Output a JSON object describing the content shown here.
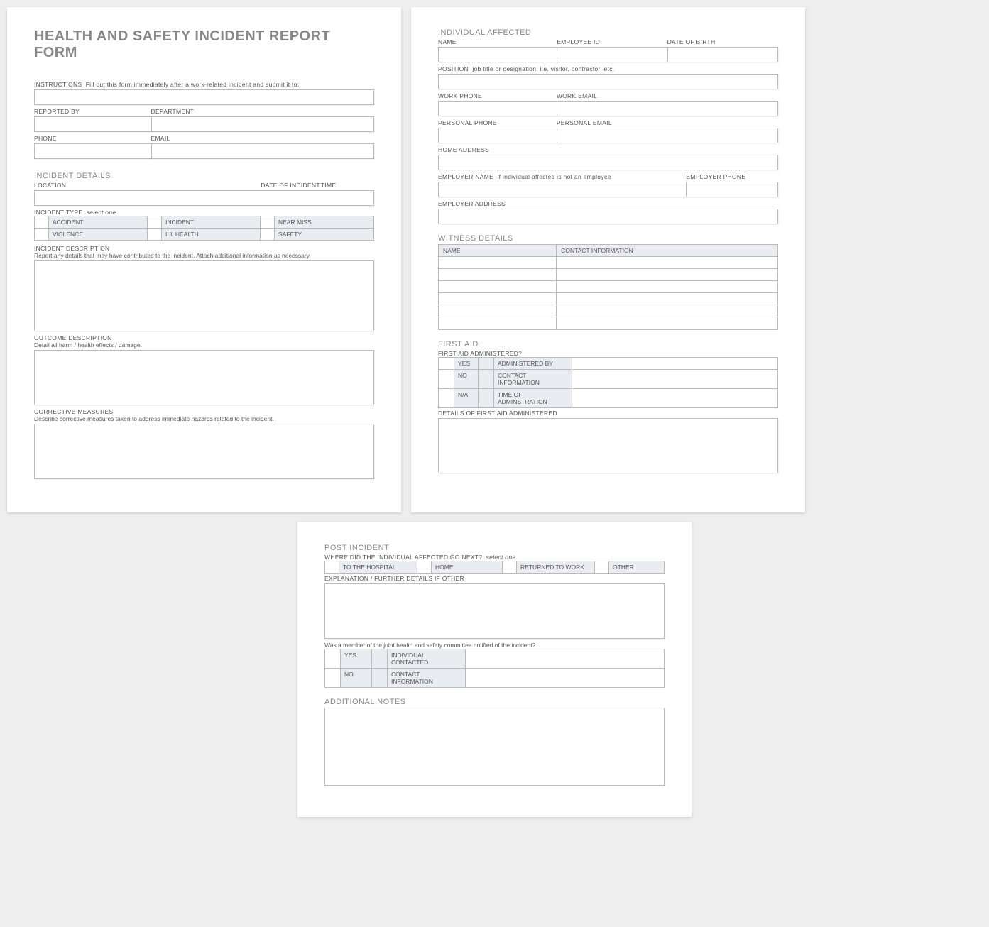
{
  "title": "HEALTH AND SAFETY INCIDENT REPORT FORM",
  "instructions": {
    "label": "INSTRUCTIONS",
    "text": "Fill out this form immediately after a work-related incident and submit it to:"
  },
  "reporter": {
    "reported_by_label": "REPORTED BY",
    "department_label": "DEPARTMENT",
    "phone_label": "PHONE",
    "email_label": "EMAIL"
  },
  "incident_details": {
    "heading": "INCIDENT DETAILS",
    "location_label": "LOCATION",
    "date_label": "DATE OF INCIDENT",
    "time_label": "TIME",
    "type_label": "INCIDENT TYPE",
    "select_one": "select one",
    "types": [
      "ACCIDENT",
      "INCIDENT",
      "NEAR MISS",
      "VIOLENCE",
      "ILL HEALTH",
      "SAFETY"
    ],
    "description_label": "INCIDENT DESCRIPTION",
    "description_note": "Report any details that may have contributed to the incident.  Attach additional information as necessary.",
    "outcome_label": "OUTCOME DESCRIPTION",
    "outcome_note": "Detail all harm / health effects / damage.",
    "corrective_label": "CORRECTIVE MEASURES",
    "corrective_note": "Describe corrective measures taken to address immediate hazards related to the incident."
  },
  "individual": {
    "heading": "INDIVIDUAL AFFECTED",
    "name_label": "NAME",
    "emp_id_label": "EMPLOYEE ID",
    "dob_label": "DATE OF BIRTH",
    "position_label": "POSITION",
    "position_note": "job title or designation, i.e. visitor, contractor, etc.",
    "work_phone_label": "WORK PHONE",
    "work_email_label": "WORK EMAIL",
    "personal_phone_label": "PERSONAL PHONE",
    "personal_email_label": "PERSONAL EMAIL",
    "home_address_label": "HOME ADDRESS",
    "employer_name_label": "EMPLOYER NAME",
    "employer_name_note": "if individual affected is not an employee",
    "employer_phone_label": "EMPLOYER PHONE",
    "employer_address_label": "EMPLOYER ADDRESS"
  },
  "witness": {
    "heading": "WITNESS DETAILS",
    "name_col": "NAME",
    "contact_col": "CONTACT INFORMATION"
  },
  "first_aid": {
    "heading": "FIRST AID",
    "administered_q": "FIRST AID ADMINISTERED?",
    "yes": "YES",
    "no": "NO",
    "na": "N/A",
    "admin_by": "ADMINISTERED BY",
    "contact_info": "CONTACT INFORMATION",
    "time_admin": "TIME OF ADMINSTRATION",
    "details_label": "DETAILS OF FIRST AID ADMINISTERED"
  },
  "post_incident": {
    "heading": "POST INCIDENT",
    "where_q": "WHERE DID THE INDIVIDUAL AFFECTED GO NEXT?",
    "select_one": "select one",
    "options": [
      "TO THE HOSPITAL",
      "HOME",
      "RETURNED TO WORK",
      "OTHER"
    ],
    "explanation_label": "EXPLANATION / FURTHER DETAILS IF OTHER",
    "committee_q": "Was a member of the joint health and safety committee notified of the incident?",
    "yes": "YES",
    "no": "NO",
    "ind_contacted": "INDIVIDUAL CONTACTED",
    "contact_info": "CONTACT INFORMATION"
  },
  "additional_notes": {
    "heading": "ADDITIONAL NOTES"
  }
}
